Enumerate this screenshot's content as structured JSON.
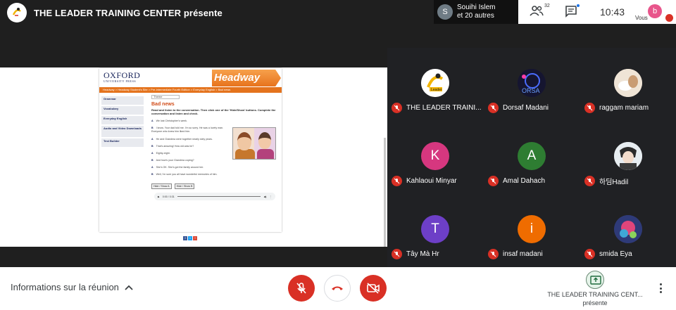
{
  "topbar": {
    "presenter_title": "THE LEADER TRAINING CENTER présente",
    "viewer_initial": "S",
    "viewer_line1": "Souihi Islem",
    "viewer_line2": "et 20 autres",
    "people_count": "32",
    "clock": "10:43",
    "you_initial": "b",
    "you_label": "Vous"
  },
  "slide": {
    "publisher": "OXFORD",
    "publisher_sub": "UNIVERSITY PRESS",
    "brand": "Headway",
    "breadcrumb": "Headway > Headway Student's Site > Pre-intermediate Fourth Edition > Everyday English > Bad news",
    "sidebar": [
      "Grammar",
      "Vocabulary",
      "Everyday English",
      "Audio and Video Downloads",
      "Test Builder"
    ],
    "select_value": "Theme",
    "heading": "Bad news",
    "instructions": "Read and listen to the conversation. Then click one of the 'Hide/Show' buttons. Complete the conversation and listen and check.",
    "dialogue": [
      {
        "speaker": "A",
        "line": "We lost Christopher's week."
      },
      {
        "speaker": "B",
        "line": "I know. Your dad told me. I'm so sorry. He was a lovely man. Everyone who knew him liked him."
      },
      {
        "speaker": "A",
        "line": "He and Grandma were together nearly sixty years."
      },
      {
        "speaker": "B",
        "line": "That's amazing! How old was he?"
      },
      {
        "speaker": "A",
        "line": "Eighty-eight."
      },
      {
        "speaker": "B",
        "line": "And how's your Grandma coping?"
      },
      {
        "speaker": "A",
        "line": "She's OK. She's got the family around her."
      },
      {
        "speaker": "B",
        "line": "Well, I'm sure you all have wonderful memories of him."
      }
    ],
    "hide_button": "Hide / Show A",
    "show_button": "Hide / Show B",
    "audio_time": "0:00 / 0:31"
  },
  "participants": [
    {
      "name": "THE LEADER TRAINI...",
      "initial": "",
      "color": "#ffffff",
      "kind": "leader"
    },
    {
      "name": "Dorsaf Madani",
      "initial": "",
      "color": "#1d1d3a",
      "kind": "dorsaf"
    },
    {
      "name": "raggam mariam",
      "initial": "",
      "color": "#e8dccf",
      "kind": "photo1"
    },
    {
      "name": "Kahlaoui Minyar",
      "initial": "K",
      "color": "#d6377f"
    },
    {
      "name": "Amal Dahach",
      "initial": "A",
      "color": "#2e7d32"
    },
    {
      "name": "하딤Hadil",
      "initial": "",
      "color": "#dfe7ee",
      "kind": "photo2"
    },
    {
      "name": "Tây Mà Hr",
      "initial": "T",
      "color": "#6d3fc7"
    },
    {
      "name": "insaf madani",
      "initial": "i",
      "color": "#ef6c00"
    },
    {
      "name": "smida Eya",
      "initial": "",
      "color": "#3b3b6b",
      "kind": "photo3"
    }
  ],
  "bottombar": {
    "meeting_info": "Informations sur la réunion",
    "presenting_label": "THE LEADER TRAINING CENT...",
    "presenting_sub": "présente"
  },
  "colors": {
    "accent_red": "#d93025",
    "headway_orange": "#e4731d",
    "oxford_navy": "#17235a"
  }
}
